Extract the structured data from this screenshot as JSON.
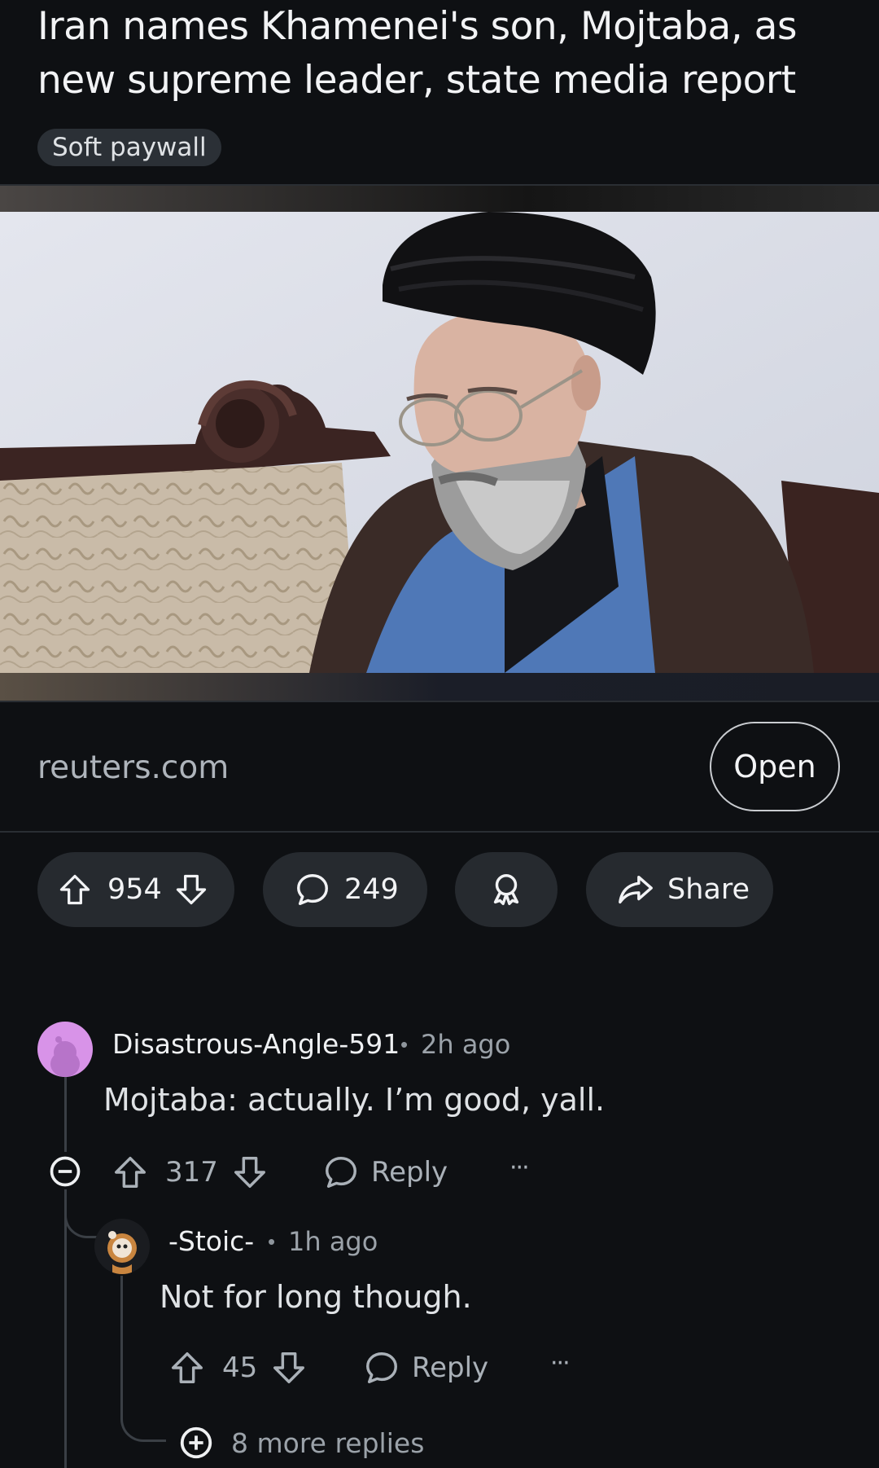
{
  "post": {
    "title": "Iran names Khamenei's son, Mojtaba, as new supreme leader, state media report",
    "flair": "Soft paywall"
  },
  "link": {
    "domain": "reuters.com",
    "open_label": "Open"
  },
  "actions": {
    "score": "954",
    "comment_count": "249",
    "share_label": "Share"
  },
  "comments": [
    {
      "author": "Disastrous-Angle-591",
      "time": "2h ago",
      "body": "Mojtaba: actually. I’m good, yall.",
      "score": "317",
      "reply_label": "Reply",
      "more_label": "···"
    },
    {
      "author": "-Stoic-",
      "time": "1h ago",
      "body": "Not for long though.",
      "score": "45",
      "reply_label": "Reply",
      "more_label": "···",
      "more_replies": "8 more replies"
    }
  ],
  "separator": "•",
  "icons": {
    "upvote": "arrow-up-icon",
    "downvote": "arrow-down-icon",
    "comment": "speech-bubble-icon",
    "award": "award-ribbon-icon",
    "share": "share-arrow-icon",
    "collapse": "minus-circle-icon",
    "expand": "plus-circle-icon"
  },
  "colors": {
    "background": "#0e1013",
    "pill": "#262a2f",
    "text": "#f2f3f5",
    "muted": "#9ba2a9"
  }
}
